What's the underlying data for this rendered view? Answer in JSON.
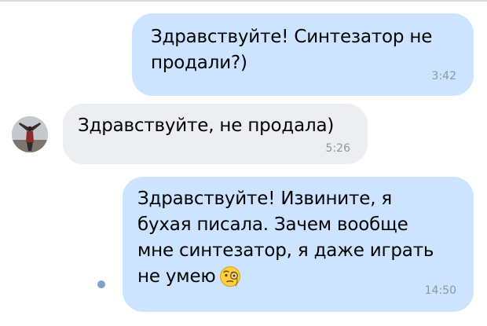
{
  "messages": [
    {
      "direction": "outgoing",
      "text": "Здравствуйте! Синтезатор не\nпродали?)",
      "time": "3:42"
    },
    {
      "direction": "incoming",
      "text": "Здравствуйте, не продала)",
      "time": "5:26"
    },
    {
      "direction": "outgoing",
      "text": "Здравствуйте! Извините, я\nбухая писала. Зачем вообще\nмне синтезатор, я даже играть\nне умею",
      "emoji": "monocle-face-icon",
      "time": "14:50"
    }
  ],
  "colors": {
    "outgoing_bubble": "#cce4ff",
    "incoming_bubble": "#eceef1",
    "timestamp": "#8c96a3",
    "unread_dot": "#7fa2cc"
  }
}
